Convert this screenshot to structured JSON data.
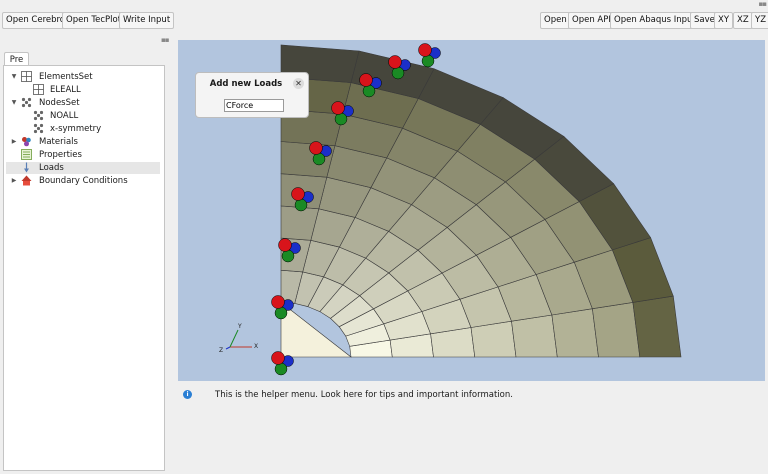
{
  "toolbar": {
    "left": [
      "Open Cerebro",
      "Open TecPlot",
      "Write Input"
    ],
    "right": [
      "Open",
      "Open API",
      "Open Abaqus Input",
      "Save",
      "XY",
      "XZ",
      "YZ"
    ]
  },
  "tabs": {
    "pre": "Pre"
  },
  "tree": {
    "items": [
      {
        "label": "ElementsSet",
        "icon": "grid-icon"
      },
      {
        "label": "ELEALL",
        "icon": "grid-icon"
      },
      {
        "label": "NodesSet",
        "icon": "nodes-icon"
      },
      {
        "label": "NOALL",
        "icon": "nodes-icon"
      },
      {
        "label": "x-symmetry",
        "icon": "nodes-icon"
      },
      {
        "label": "Materials",
        "icon": "materials-icon"
      },
      {
        "label": "Properties",
        "icon": "properties-icon"
      },
      {
        "label": "Loads",
        "icon": "loads-icon"
      },
      {
        "label": "Boundary Conditions",
        "icon": "boundary-icon"
      }
    ],
    "selected": "Loads"
  },
  "dialog": {
    "title": "Add new Loads",
    "input_value": "CForce",
    "close_icon": "close-icon"
  },
  "axes": {
    "x": "X",
    "y": "Y",
    "z": "Z"
  },
  "helper": {
    "text": "This is the helper menu. Look here for tips and important information.",
    "icon": "info-icon"
  },
  "colors": {
    "viewport_bg": "#b2c5de",
    "constraint_red": "#d8141b",
    "constraint_green": "#1a8a24",
    "constraint_blue": "#1b2fc9"
  }
}
